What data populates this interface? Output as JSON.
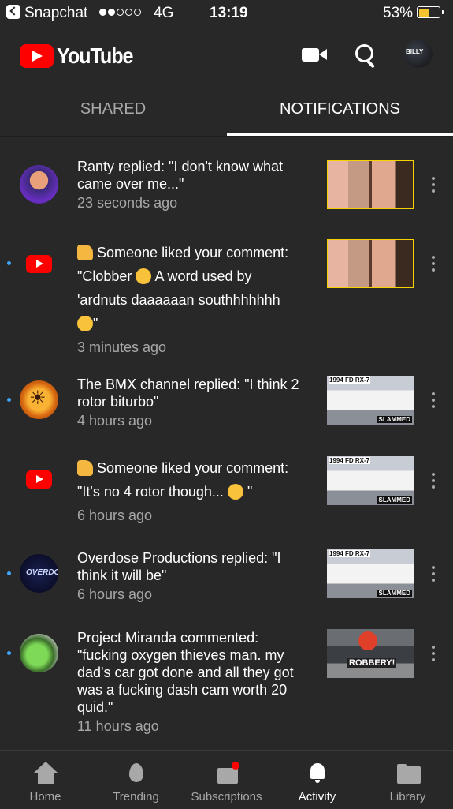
{
  "status_bar": {
    "carrier": "Snapchat",
    "network": "4G",
    "time": "13:19",
    "battery_percent": "53%",
    "signal_bars": 2,
    "battery_level": 0.53
  },
  "app_bar": {
    "brand": "YouTube",
    "avatar_text": "BILLY",
    "icons": [
      "camera-icon",
      "search-icon"
    ]
  },
  "tabs": [
    {
      "label": "SHARED"
    },
    {
      "label": "NOTIFICATIONS"
    }
  ],
  "notifications": [
    {
      "lines": [
        "Ranty replied: \"I don't know what",
        "came over me...\""
      ],
      "time": "23 seconds ago"
    },
    {
      "lines": [
        "Someone liked your comment:",
        "\"Clobber",
        "A word used by",
        "'ardnuts daaaaaan southhhhhhh",
        "\""
      ],
      "time": "3 minutes ago"
    },
    {
      "lines": [
        "The BMX channel replied: \"I think 2",
        "rotor biturbo\""
      ],
      "time": "4 hours ago",
      "thumb_label_top": "1994 FD RX-7",
      "thumb_label_bottom": "SLAMMED"
    },
    {
      "lines": [
        "Someone liked your comment:",
        "\"It's no 4 rotor though...",
        "\""
      ],
      "time": "6 hours ago",
      "thumb_label_top": "1994 FD RX-7",
      "thumb_label_bottom": "SLAMMED"
    },
    {
      "lines": [
        "Overdose Productions replied: \"I",
        "think it will be\""
      ],
      "time": "6 hours ago",
      "avatar_text": "OVERDOSE",
      "thumb_label_top": "1994 FD RX-7",
      "thumb_label_bottom": "SLAMMED"
    },
    {
      "lines": [
        "Project Miranda commented:",
        "\"fucking oxygen thieves man. my",
        "dad's car got done and all they got",
        "was a fucking dash cam worth 20",
        "quid.\""
      ],
      "time": "11 hours ago",
      "thumb_label": "ROBBERY!"
    }
  ],
  "bottom_nav": [
    {
      "label": "Home"
    },
    {
      "label": "Trending"
    },
    {
      "label": "Subscriptions"
    },
    {
      "label": "Activity"
    },
    {
      "label": "Library"
    }
  ],
  "colors": {
    "background": "#282828",
    "accent": "#ff0000",
    "unread_dot": "#3ea6ff",
    "secondary_text": "#a8a8a8"
  }
}
